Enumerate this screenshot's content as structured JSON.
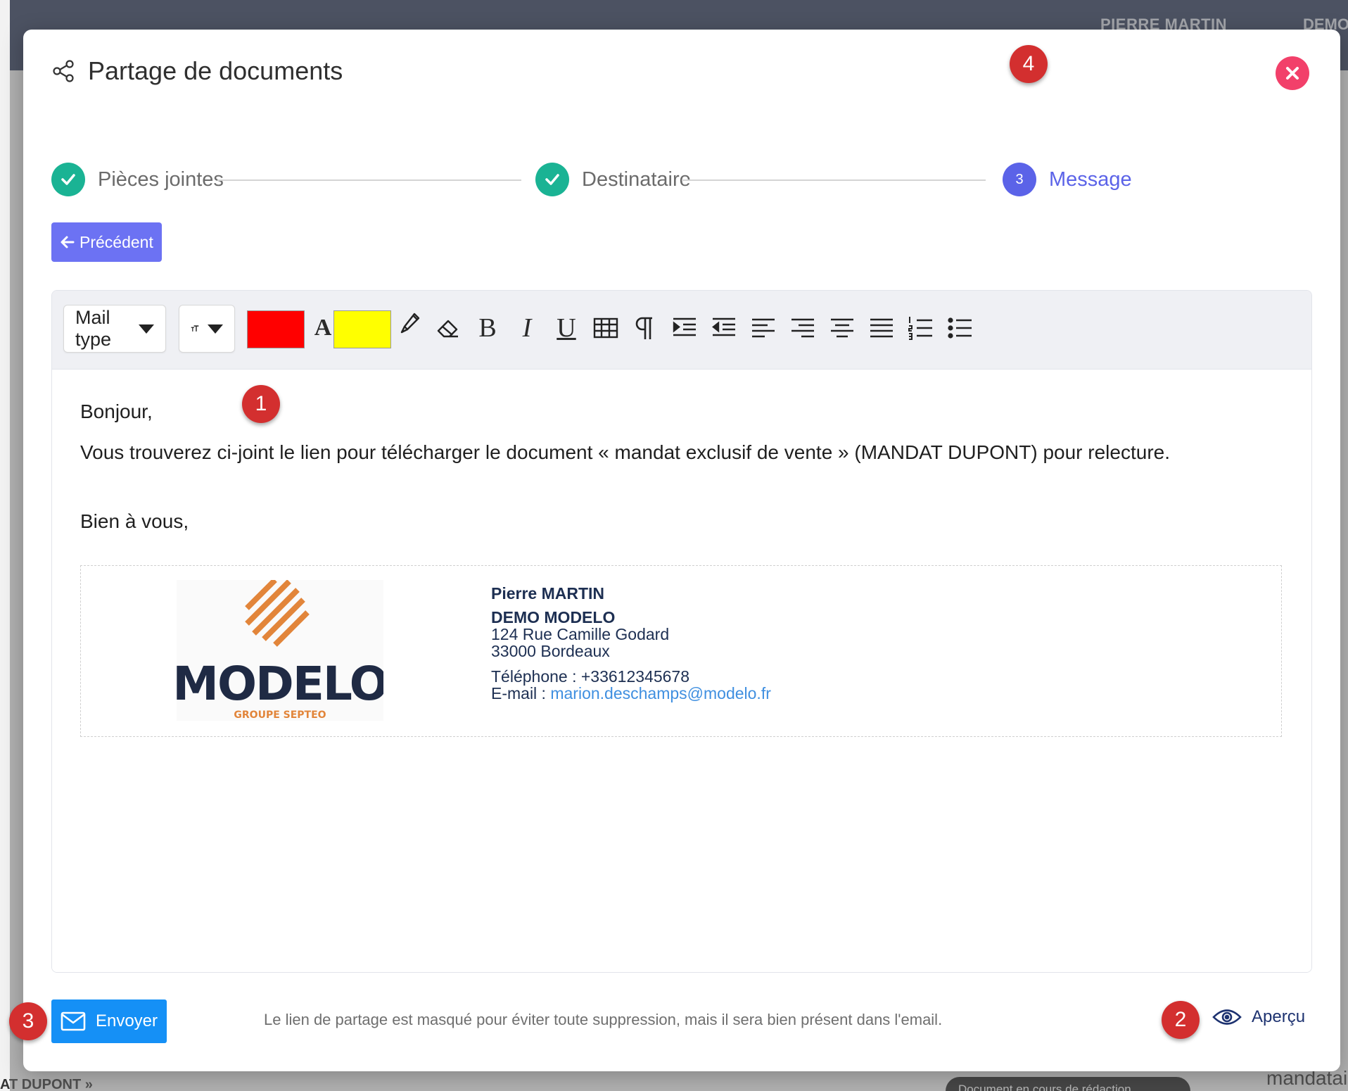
{
  "background": {
    "user_name": "PIERRE MARTIN",
    "org_short": "DEMO",
    "status_pill": "Document en cours de rédaction",
    "left_snippet": "AT DUPONT »",
    "right_snippet": "mandatai"
  },
  "modal": {
    "title": "Partage de documents",
    "close_icon": "close-x-icon"
  },
  "annotations": {
    "badge_1": "1",
    "badge_2": "2",
    "badge_3": "3",
    "badge_4": "4"
  },
  "stepper": {
    "steps": [
      {
        "label": "Pièces jointes",
        "state": "done"
      },
      {
        "label": "Destinataire",
        "state": "done"
      },
      {
        "label": "Message",
        "state": "active",
        "number": "3"
      }
    ]
  },
  "nav": {
    "previous_label": "Précédent"
  },
  "toolbar": {
    "template_select": "Mail type",
    "text_color": "#ff0000",
    "highlight_color": "#ffff00",
    "font_color_letter": "A",
    "bold_letter": "B",
    "italic_letter": "I",
    "underline_letter": "U"
  },
  "message": {
    "greeting": "Bonjour,",
    "body": "Vous trouverez ci-joint le lien pour télécharger le document « mandat exclusif de vente » (MANDAT DUPONT) pour relecture.",
    "closing": "Bien à vous,"
  },
  "signature": {
    "name": "Pierre MARTIN",
    "company": "DEMO MODELO",
    "address_line1": "124 Rue Camille Godard",
    "address_line2": "33000 Bordeaux",
    "phone_label": "Téléphone : ",
    "phone": "+33612345678",
    "email_label": "E-mail : ",
    "email": "marion.deschamps@modelo.fr",
    "logo_text": "MODELO",
    "logo_subtext": "GROUPE SEPTEO"
  },
  "footer": {
    "send_label": "Envoyer",
    "note": "Le lien de partage est masqué pour éviter toute suppression, mais il sera bien présent dans l'email.",
    "preview_label": "Aperçu"
  },
  "colors": {
    "accent": "#5b63e8",
    "success": "#1ab394",
    "send": "#1590f6",
    "close": "#f2406a",
    "badge": "#d32f2f"
  }
}
